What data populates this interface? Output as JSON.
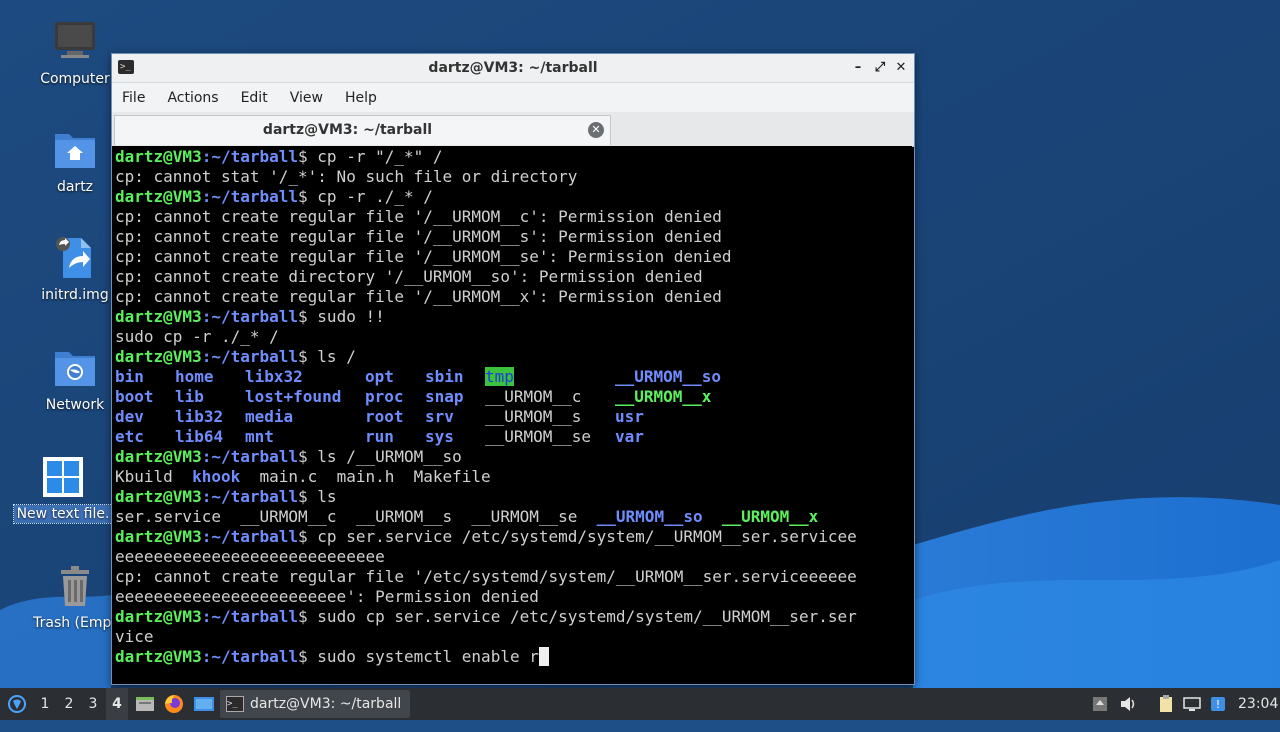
{
  "desktop": {
    "icons": [
      {
        "label": "Computer",
        "icon": "computer-icon"
      },
      {
        "label": "dartz",
        "icon": "home-folder-icon"
      },
      {
        "label": "initrd.img",
        "icon": "symlink-file-icon"
      },
      {
        "label": "Network",
        "icon": "network-folder-icon"
      },
      {
        "label": "New text file.",
        "icon": "text-file-icon",
        "selected": true
      },
      {
        "label": "Trash (Empt",
        "icon": "trash-icon"
      }
    ]
  },
  "window": {
    "title": "dartz@VM3: ~/tarball",
    "controls": {
      "minimize": "–",
      "maximize": "⤢",
      "close": "✕"
    },
    "menu": [
      "File",
      "Actions",
      "Edit",
      "View",
      "Help"
    ],
    "tab": {
      "label": "dartz@VM3: ~/tarball",
      "close": "✕"
    }
  },
  "terminal": {
    "prompt_user": "dartz@VM3",
    "prompt_path": ":~/tarball",
    "prompt_end": "$ ",
    "lines": [
      {
        "t": "cmd",
        "text": "cp -r \"/_*\" /"
      },
      {
        "t": "out",
        "text": "cp: cannot stat '/_*': No such file or directory"
      },
      {
        "t": "cmd",
        "text": "cp -r ./_* /"
      },
      {
        "t": "out",
        "text": "cp: cannot create regular file '/__URMOM__c': Permission denied"
      },
      {
        "t": "out",
        "text": "cp: cannot create regular file '/__URMOM__s': Permission denied"
      },
      {
        "t": "out",
        "text": "cp: cannot create regular file '/__URMOM__se': Permission denied"
      },
      {
        "t": "out",
        "text": "cp: cannot create directory '/__URMOM__so': Permission denied"
      },
      {
        "t": "out",
        "text": "cp: cannot create regular file '/__URMOM__x': Permission denied"
      },
      {
        "t": "cmd",
        "text": "sudo !!"
      },
      {
        "t": "out",
        "text": "sudo cp -r ./_* /"
      },
      {
        "t": "cmd",
        "text": "ls /"
      },
      {
        "t": "cols",
        "cells": [
          {
            "text": "bin",
            "s": "dir"
          },
          {
            "text": "home",
            "s": "dir"
          },
          {
            "text": "libx32",
            "s": "dir"
          },
          {
            "text": "opt",
            "s": "dir"
          },
          {
            "text": "sbin",
            "s": "dir"
          },
          {
            "text": "tmp",
            "s": "hl"
          },
          {
            "text": "__URMOM__so",
            "s": "dir"
          }
        ]
      },
      {
        "t": "cols",
        "cells": [
          {
            "text": "boot",
            "s": "dir"
          },
          {
            "text": "lib",
            "s": "dir"
          },
          {
            "text": "lost+found",
            "s": "dir"
          },
          {
            "text": "proc",
            "s": "dir"
          },
          {
            "text": "snap",
            "s": "dir"
          },
          {
            "text": "__URMOM__c",
            "s": "plain"
          },
          {
            "text": "__URMOM__x",
            "s": "grn"
          }
        ]
      },
      {
        "t": "cols",
        "cells": [
          {
            "text": "dev",
            "s": "dir"
          },
          {
            "text": "lib32",
            "s": "dir"
          },
          {
            "text": "media",
            "s": "dir"
          },
          {
            "text": "root",
            "s": "dir"
          },
          {
            "text": "srv",
            "s": "dir"
          },
          {
            "text": "__URMOM__s",
            "s": "plain"
          },
          {
            "text": "usr",
            "s": "dir"
          }
        ]
      },
      {
        "t": "cols",
        "cells": [
          {
            "text": "etc",
            "s": "dir"
          },
          {
            "text": "lib64",
            "s": "dir"
          },
          {
            "text": "mnt",
            "s": "dir"
          },
          {
            "text": "run",
            "s": "dir"
          },
          {
            "text": "sys",
            "s": "dir"
          },
          {
            "text": "__URMOM__se",
            "s": "plain"
          },
          {
            "text": "var",
            "s": "dir"
          }
        ]
      },
      {
        "t": "cmd",
        "text": "ls /__URMOM__so"
      },
      {
        "t": "seg",
        "cells": [
          {
            "text": "Kbuild  ",
            "s": "plain"
          },
          {
            "text": "khook",
            "s": "dir"
          },
          {
            "text": "  main.c  main.h  Makefile",
            "s": "plain"
          }
        ]
      },
      {
        "t": "cmd",
        "text": "ls"
      },
      {
        "t": "seg",
        "cells": [
          {
            "text": "ser.service  __URMOM__c  __URMOM__s  __URMOM__se  ",
            "s": "plain"
          },
          {
            "text": "__URMOM__so",
            "s": "dir"
          },
          {
            "text": "  ",
            "s": "plain"
          },
          {
            "text": "__URMOM__x",
            "s": "grn"
          }
        ]
      },
      {
        "t": "cmd",
        "text": "cp ser.service /etc/systemd/system/__URMOM__ser.servicee"
      },
      {
        "t": "out",
        "text": "eeeeeeeeeeeeeeeeeeeeeeeeeeee"
      },
      {
        "t": "out",
        "text": "cp: cannot create regular file '/etc/systemd/system/__URMOM__ser.serviceeeeee"
      },
      {
        "t": "out",
        "text": "eeeeeeeeeeeeeeeeeeeeeeee': Permission denied"
      },
      {
        "t": "cmd",
        "text": "sudo cp ser.service /etc/systemd/system/__URMOM__ser.ser"
      },
      {
        "t": "out",
        "text": "vice"
      },
      {
        "t": "cmd",
        "text": "sudo systemctl enable r",
        "cursor": true
      }
    ]
  },
  "taskbar": {
    "workspaces": [
      "1",
      "2",
      "3",
      "4"
    ],
    "active_workspace": "4",
    "task_label": "dartz@VM3: ~/tarball",
    "clock": "23:04"
  }
}
